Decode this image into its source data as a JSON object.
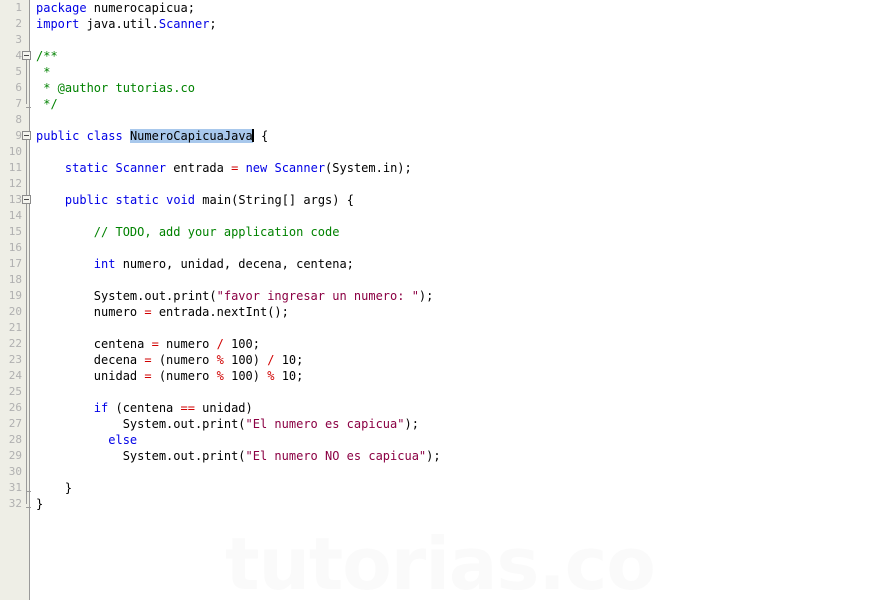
{
  "editor": {
    "language": "Java",
    "watermark": "tutorias.co",
    "line_height": 16,
    "colors": {
      "background": "#ffffff",
      "gutter_background": "#eeeee6",
      "line_number": "#b0b0b0",
      "keyword": "#0000e6",
      "comment": "#008200",
      "string": "#8b0043",
      "operator": "#d00000",
      "plain": "#000000",
      "selection": "#a8c8ec",
      "watermark": "#fafafa"
    },
    "selection": {
      "text": "NumeroCapicuaJava",
      "line": 9
    }
  },
  "gutter": {
    "numbers": [
      "1",
      "2",
      "3",
      "4",
      "5",
      "6",
      "7",
      "8",
      "9",
      "10",
      "11",
      "12",
      "13",
      "14",
      "15",
      "16",
      "17",
      "18",
      "19",
      "20",
      "21",
      "22",
      "23",
      "24",
      "25",
      "26",
      "27",
      "28",
      "29",
      "30",
      "31",
      "32"
    ],
    "fold_markers": [
      {
        "line": 4,
        "type": "open"
      },
      {
        "line": 7,
        "type": "end"
      },
      {
        "line": 9,
        "type": "open"
      },
      {
        "line": 13,
        "type": "open"
      },
      {
        "line": 31,
        "type": "end"
      },
      {
        "line": 32,
        "type": "end"
      }
    ]
  },
  "code": {
    "lines": [
      {
        "n": 1,
        "text": "package numerocapicua;"
      },
      {
        "n": 2,
        "text": "import java.util.Scanner;"
      },
      {
        "n": 3,
        "text": ""
      },
      {
        "n": 4,
        "text": "/**"
      },
      {
        "n": 5,
        "text": " *"
      },
      {
        "n": 6,
        "text": " * @author tutorias.co"
      },
      {
        "n": 7,
        "text": " */"
      },
      {
        "n": 8,
        "text": ""
      },
      {
        "n": 9,
        "text": "public class NumeroCapicuaJava {"
      },
      {
        "n": 10,
        "text": ""
      },
      {
        "n": 11,
        "text": "    static Scanner entrada = new Scanner(System.in);"
      },
      {
        "n": 12,
        "text": ""
      },
      {
        "n": 13,
        "text": "    public static void main(String[] args) {"
      },
      {
        "n": 14,
        "text": ""
      },
      {
        "n": 15,
        "text": "        // TODO, add your application code"
      },
      {
        "n": 16,
        "text": ""
      },
      {
        "n": 17,
        "text": "        int numero, unidad, decena, centena;"
      },
      {
        "n": 18,
        "text": ""
      },
      {
        "n": 19,
        "text": "        System.out.print(\"favor ingresar un numero: \");"
      },
      {
        "n": 20,
        "text": "        numero = entrada.nextInt();"
      },
      {
        "n": 21,
        "text": ""
      },
      {
        "n": 22,
        "text": "        centena = numero / 100;"
      },
      {
        "n": 23,
        "text": "        decena = (numero % 100) / 10;"
      },
      {
        "n": 24,
        "text": "        unidad = (numero % 100) % 10;"
      },
      {
        "n": 25,
        "text": ""
      },
      {
        "n": 26,
        "text": "        if (centena == unidad)"
      },
      {
        "n": 27,
        "text": "            System.out.print(\"El numero es capicua\");"
      },
      {
        "n": 28,
        "text": "          else"
      },
      {
        "n": 29,
        "text": "            System.out.print(\"El numero NO es capicua\");"
      },
      {
        "n": 30,
        "text": ""
      },
      {
        "n": 31,
        "text": "    }"
      },
      {
        "n": 32,
        "text": "}"
      }
    ]
  },
  "tokens": {
    "l1": {
      "kw": "package",
      "rest": " numerocapicua;"
    },
    "l2": {
      "kw": "import",
      "rest": " java.util.",
      "typ": "Scanner",
      "tail": ";"
    },
    "l4": {
      "cmt": "/**"
    },
    "l5": {
      "cmt": " *"
    },
    "l6": {
      "cmt": " * @author tutorias.co"
    },
    "l7": {
      "cmt": " */"
    },
    "l9": {
      "kw1": "public",
      "kw2": "class",
      "sel": "NumeroCapicuaJava",
      "tail": " {"
    },
    "l11": {
      "kw": "static",
      "typ1": "Scanner",
      "name": " entrada ",
      "op": "=",
      "kw2": " new ",
      "typ2": "Scanner",
      "tail": "(System.in);"
    },
    "l13": {
      "kw1": "public",
      "kw2": "static",
      "kw3": "void",
      "tail": " main(String[] args) {"
    },
    "l15": {
      "cmt": "// TODO, add your application code"
    },
    "l17": {
      "kw": "int",
      "rest": " numero, unidad, decena, centena;"
    },
    "l19": {
      "pre": "System.out.print(",
      "str": "\"favor ingresar un numero: \"",
      "tail": ");"
    },
    "l20": {
      "text": "numero ",
      "op": "=",
      "tail": " entrada.nextInt();"
    },
    "l22": {
      "a": "centena ",
      "op1": "=",
      "b": " numero ",
      "op2": "/",
      "c": " 100;"
    },
    "l23": {
      "a": "decena ",
      "op1": "=",
      "b": " (numero ",
      "op2": "%",
      "c": " 100) ",
      "op3": "/",
      "d": " 10;"
    },
    "l24": {
      "a": "unidad ",
      "op1": "=",
      "b": " (numero ",
      "op2": "%",
      "c": " 100) ",
      "op3": "%",
      "d": " 10;"
    },
    "l26": {
      "kw": "if",
      "a": " (centena ",
      "op": "==",
      "b": " unidad)"
    },
    "l27": {
      "pre": "System.out.print(",
      "str": "\"El numero es capicua\"",
      "tail": ");"
    },
    "l28": {
      "kw": "else"
    },
    "l29": {
      "pre": "System.out.print(",
      "str": "\"El numero NO es capicua\"",
      "tail": ");"
    },
    "l31": {
      "text": "}"
    },
    "l32": {
      "text": "}"
    }
  }
}
